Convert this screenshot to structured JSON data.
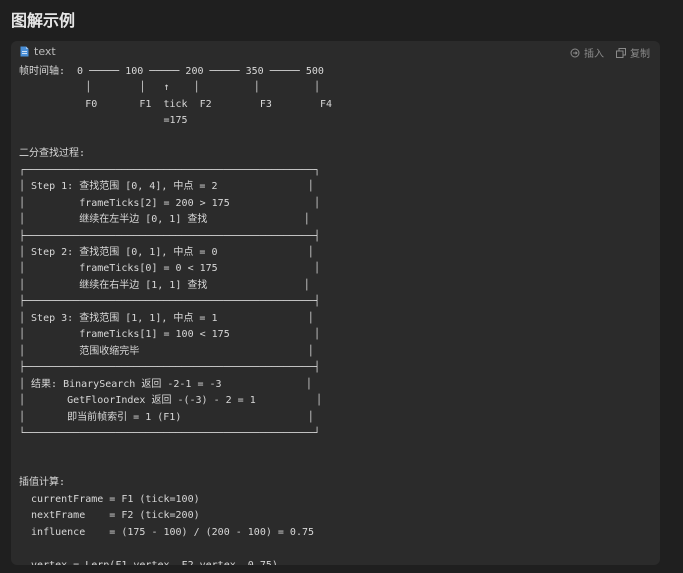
{
  "page": {
    "title": "图解示例"
  },
  "code_block": {
    "language": "text",
    "actions": {
      "insert_label": "插入",
      "copy_label": "复制"
    },
    "lines": [
      "帧时间轴:  0 ───── 100 ───── 200 ───── 350 ───── 500",
      "           │        │   ↑    │         │         │",
      "           F0       F1  tick  F2        F3        F4",
      "                        =175",
      "",
      "二分查找过程:",
      "┌────────────────────────────────────────────────┐",
      "│ Step 1: 查找范围 [0, 4], 中点 = 2               │",
      "│         frameTicks[2] = 200 > 175              │",
      "│         继续在左半边 [0, 1] 查找                │",
      "├────────────────────────────────────────────────┤",
      "│ Step 2: 查找范围 [0, 1], 中点 = 0               │",
      "│         frameTicks[0] = 0 < 175                │",
      "│         继续在右半边 [1, 1] 查找                │",
      "├────────────────────────────────────────────────┤",
      "│ Step 3: 查找范围 [1, 1], 中点 = 1               │",
      "│         frameTicks[1] = 100 < 175              │",
      "│         范围收缩完毕                            │",
      "├────────────────────────────────────────────────┤",
      "│ 结果: BinarySearch 返回 -2-1 = -3              │",
      "│       GetFloorIndex 返回 -(-3) - 2 = 1          │",
      "│       即当前帧索引 = 1 (F1)                     │",
      "└────────────────────────────────────────────────┘",
      "",
      "",
      "插值计算:",
      "  currentFrame = F1 (tick=100)",
      "  nextFrame    = F2 (tick=200)",
      "  influence    = (175 - 100) / (200 - 100) = 0.75",
      "",
      "  vertex = Lerp(F1.vertex, F2.vertex, 0.75)"
    ]
  }
}
